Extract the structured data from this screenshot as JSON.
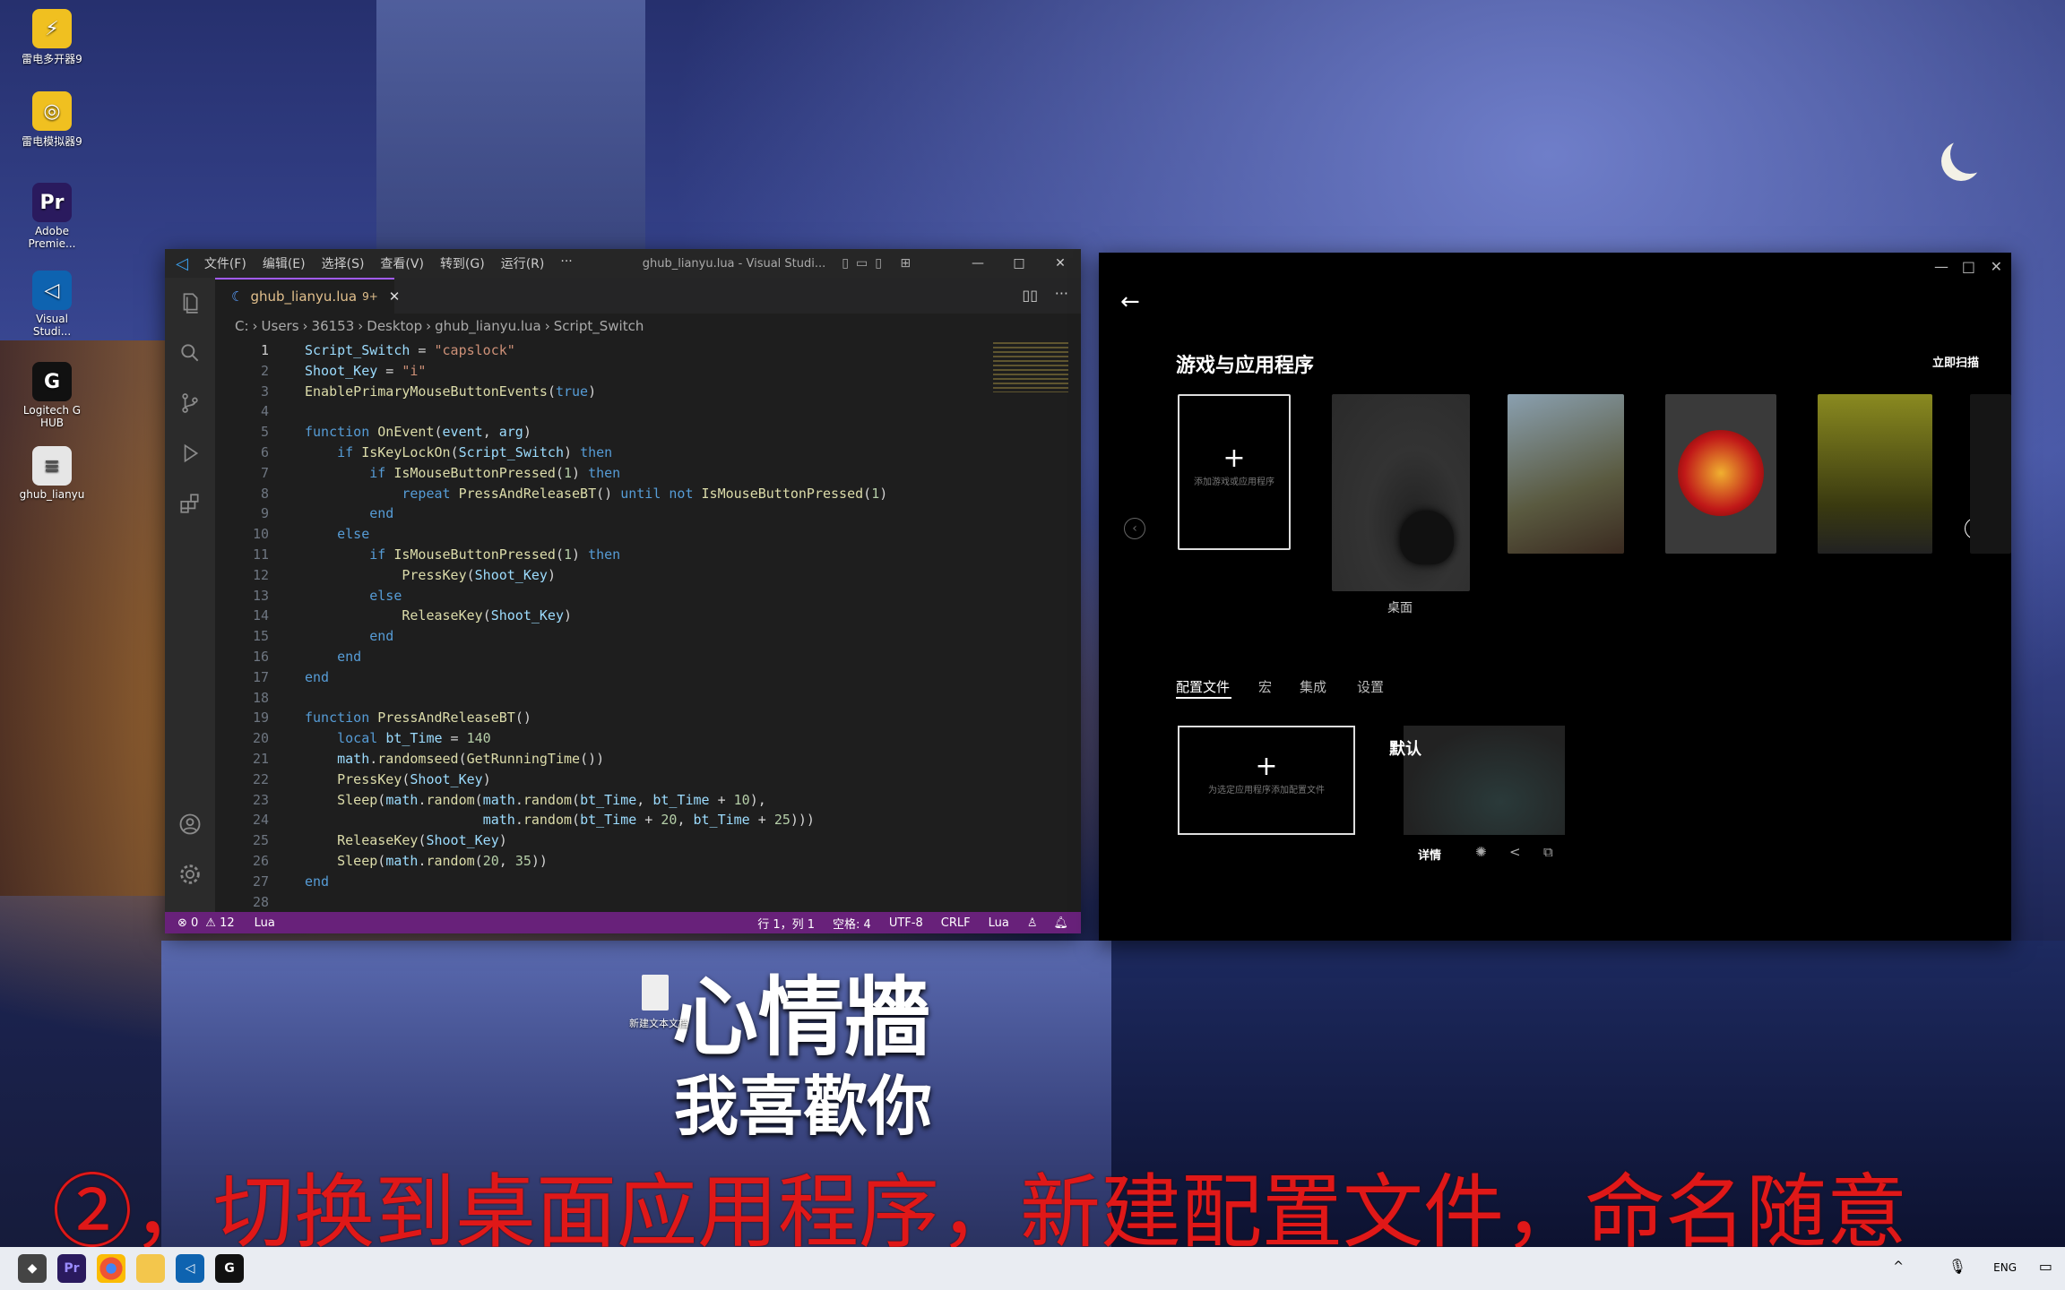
{
  "desktop": {
    "icons": [
      {
        "label": "雷电多开器9",
        "glyph": "⚡",
        "color": "#f0c020"
      },
      {
        "label": "雷电模拟器9",
        "glyph": "◎",
        "color": "#f0c020"
      },
      {
        "label": "Adobe Premie...",
        "glyph": "Pr",
        "color": "#2a1a5e"
      },
      {
        "label": "Visual Studi...",
        "glyph": "◁",
        "color": "#0e63b0"
      },
      {
        "label": "Logitech G HUB",
        "glyph": "G",
        "color": "#111111"
      },
      {
        "label": "ghub_lianyu",
        "glyph": "≡",
        "color": "#e6e6e6"
      },
      {
        "label": "新建文本文档",
        "glyph": "≡",
        "color": "#e6e6e6"
      }
    ],
    "overlay_title": "心情牆",
    "overlay_sub": "我喜歡你",
    "caption": "②，切换到桌面应用程序，新建配置文件，命名随意"
  },
  "vscode": {
    "menu": [
      "文件(F)",
      "编辑(E)",
      "选择(S)",
      "查看(V)",
      "转到(G)",
      "运行(R)",
      "···"
    ],
    "window_title": "ghub_lianyu.lua - Visual Studi...",
    "tab_label": "ghub_lianyu.lua",
    "tab_badge": "9+",
    "breadcrumb": [
      "C:",
      "Users",
      "36153",
      "Desktop",
      "ghub_lianyu.lua",
      "Script_Switch"
    ],
    "code": [
      {
        "n": "1",
        "html": "<span class='vr'>Script_Switch</span> = <span class='st'>\"capslock\"</span>"
      },
      {
        "n": "2",
        "html": "<span class='vr'>Shoot_Key</span> = <span class='st'>\"i\"</span>"
      },
      {
        "n": "3",
        "html": "<span class='fn'>EnablePrimaryMouseButtonEvents</span>(<span class='kw'>true</span>)"
      },
      {
        "n": "4",
        "html": ""
      },
      {
        "n": "5",
        "html": "<span class='kw'>function</span> <span class='fn'>OnEvent</span>(<span class='vr'>event</span>, <span class='vr'>arg</span>)"
      },
      {
        "n": "6",
        "html": "    <span class='kw'>if</span> <span class='fn'>IsKeyLockOn</span>(<span class='vr'>Script_Switch</span>) <span class='kw'>then</span>"
      },
      {
        "n": "7",
        "html": "        <span class='kw'>if</span> <span class='fn'>IsMouseButtonPressed</span>(<span class='nm'>1</span>) <span class='kw'>then</span>"
      },
      {
        "n": "8",
        "html": "            <span class='kw'>repeat</span> <span class='fn'>PressAndReleaseBT</span>() <span class='kw'>until</span> <span class='kw'>not</span> <span class='fn'>IsMouseButtonPressed</span>(<span class='nm'>1</span>)"
      },
      {
        "n": "9",
        "html": "        <span class='kw'>end</span>"
      },
      {
        "n": "10",
        "html": "    <span class='kw'>else</span>"
      },
      {
        "n": "11",
        "html": "        <span class='kw'>if</span> <span class='fn'>IsMouseButtonPressed</span>(<span class='nm'>1</span>) <span class='kw'>then</span>"
      },
      {
        "n": "12",
        "html": "            <span class='fn'>PressKey</span>(<span class='vr'>Shoot_Key</span>)"
      },
      {
        "n": "13",
        "html": "        <span class='kw'>else</span>"
      },
      {
        "n": "14",
        "html": "            <span class='fn'>ReleaseKey</span>(<span class='vr'>Shoot_Key</span>)"
      },
      {
        "n": "15",
        "html": "        <span class='kw'>end</span>"
      },
      {
        "n": "16",
        "html": "    <span class='kw'>end</span>"
      },
      {
        "n": "17",
        "html": "<span class='kw'>end</span>"
      },
      {
        "n": "18",
        "html": ""
      },
      {
        "n": "19",
        "html": "<span class='kw'>function</span> <span class='fn'>PressAndReleaseBT</span>()"
      },
      {
        "n": "20",
        "html": "    <span class='kw'>local</span> <span class='vr'>bt_Time</span> = <span class='nm'>140</span>"
      },
      {
        "n": "21",
        "html": "    <span class='vr'>math</span>.<span class='fn'>randomseed</span>(<span class='fn'>GetRunningTime</span>())"
      },
      {
        "n": "22",
        "html": "    <span class='fn'>PressKey</span>(<span class='vr'>Shoot_Key</span>)"
      },
      {
        "n": "23",
        "html": "    <span class='fn'>Sleep</span>(<span class='vr'>math</span>.<span class='fn'>random</span>(<span class='vr'>math</span>.<span class='fn'>random</span>(<span class='vr'>bt_Time</span>, <span class='vr'>bt_Time</span> + <span class='nm'>10</span>),"
      },
      {
        "n": "24",
        "html": "                      <span class='vr'>math</span>.<span class='fn'>random</span>(<span class='vr'>bt_Time</span> + <span class='nm'>20</span>, <span class='vr'>bt_Time</span> + <span class='nm'>25</span>)))"
      },
      {
        "n": "25",
        "html": "    <span class='fn'>ReleaseKey</span>(<span class='vr'>Shoot_Key</span>)"
      },
      {
        "n": "26",
        "html": "    <span class='fn'>Sleep</span>(<span class='vr'>math</span>.<span class='fn'>random</span>(<span class='nm'>20</span>, <span class='nm'>35</span>))"
      },
      {
        "n": "27",
        "html": "<span class='kw'>end</span>"
      },
      {
        "n": "28",
        "html": ""
      }
    ],
    "status": {
      "errors": "⊗ 0",
      "warnings": "⚠ 12",
      "language_left": "Lua",
      "position": "行 1，列 1",
      "spaces": "空格: 4",
      "encoding": "UTF-8",
      "eol": "CRLF",
      "language": "Lua"
    }
  },
  "ghub": {
    "section_title": "游戏与应用程序",
    "scan_label": "立即扫描",
    "add_game_label": "添加游戏或应用程序",
    "desktop_label": "桌面",
    "tabs": [
      "配置文件",
      "宏",
      "集成",
      "设置"
    ],
    "add_profile_label": "为选定应用程序添加配置文件",
    "default_profile": "默认",
    "details_label": "详情"
  },
  "taskbar": {
    "lang": "ENG"
  }
}
